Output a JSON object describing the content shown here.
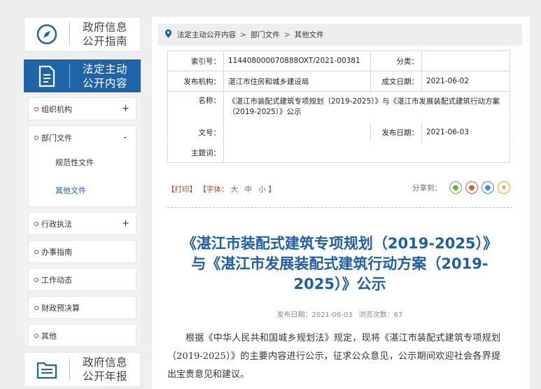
{
  "sidebar": {
    "banner_guide": {
      "line1": "政府信息",
      "line2": "公开指南",
      "icon": "compass-icon"
    },
    "banner_active": {
      "line1": "法定主动",
      "line2": "公开内容",
      "icon": "document-icon"
    },
    "banner_report": {
      "line1": "政府信息",
      "line2": "公开年报",
      "icon": "folder-icon"
    },
    "menu": [
      {
        "label": "组织机构",
        "toggle": "+"
      },
      {
        "label": "部门文件",
        "toggle": "-",
        "children": [
          "规范性文件",
          "其他文件"
        ]
      },
      {
        "label": "行政执法",
        "toggle": "+"
      },
      {
        "label": "办事指南",
        "toggle": ""
      },
      {
        "label": "工作动态",
        "toggle": ""
      },
      {
        "label": "财政预决算",
        "toggle": ""
      },
      {
        "label": "其他",
        "toggle": ""
      }
    ]
  },
  "breadcrumb": {
    "items": [
      "法定主动公开内容",
      "部门文件",
      "其他文件"
    ],
    "separator": ">"
  },
  "info": {
    "index_label": "索引号：",
    "index_value": "114408000070888OXT/2021-00381",
    "category_label": "分类：",
    "category_value": "",
    "publisher_label": "发布机构：",
    "publisher_value": "湛江市住房和城乡建设局",
    "date_made_label": "成文日期：",
    "date_made_value": "2021-06-02",
    "name_label": "名称：",
    "name_value": "《湛江市装配式建筑专项规划（2019-2025）》与《湛江市发展装配式建筑行动方案（2019-2025）》公示",
    "doc_no_label": "文号：",
    "doc_no_value": "",
    "pub_date_label": "发布日期：",
    "pub_date_value": "2021-06-03",
    "subject_label": "主题词：",
    "subject_value": ""
  },
  "tools": {
    "print": "【打印】",
    "font_prefix": "【字体：",
    "font_large": "大",
    "font_mid": "中",
    "font_small": "小",
    "font_suffix": "】",
    "share_label": "分享到：",
    "share_icons": [
      "wechat-icon",
      "weibo-icon",
      "qq-icon",
      "qzone-icon"
    ],
    "share_colors": [
      "#5fb336",
      "#e2573c",
      "#3a8fd8",
      "#f0a21b"
    ]
  },
  "article": {
    "title_line1": "《湛江市装配式建筑专项规划（2019-2025）》",
    "title_line2": "与《湛江市发展装配式建筑行动方案（2019-",
    "title_line3": "2025）》公示",
    "meta_date": "发布日期：2021-06-03",
    "meta_views": "浏览次数：67",
    "paragraph": "根据《中华人民共和国城乡规划法》规定，现将《湛江市装配式建筑专项规划（2019-2025）》的主要内容进行公示，征求公众意见，公示期间欢迎社会各界提出宝贵意见和建议。"
  },
  "colors": {
    "accent": "#1f5fa8",
    "active_banner": "#1f64a8",
    "red": "#c0392b"
  }
}
